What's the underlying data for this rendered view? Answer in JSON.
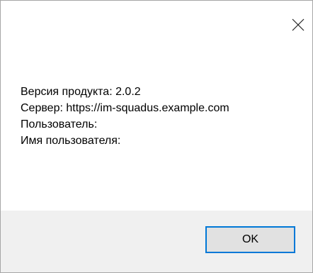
{
  "dialog": {
    "close_icon": "close-icon",
    "lines": [
      "Версия продукта: 2.0.2",
      "Сервер: https://im-squadus.example.com",
      "Пользователь:",
      "Имя пользователя:"
    ],
    "ok_label": "OK"
  },
  "colors": {
    "footer_background": "#f0f0f0",
    "button_background": "#e1e1e1",
    "button_focus_border": "#0078d7"
  }
}
